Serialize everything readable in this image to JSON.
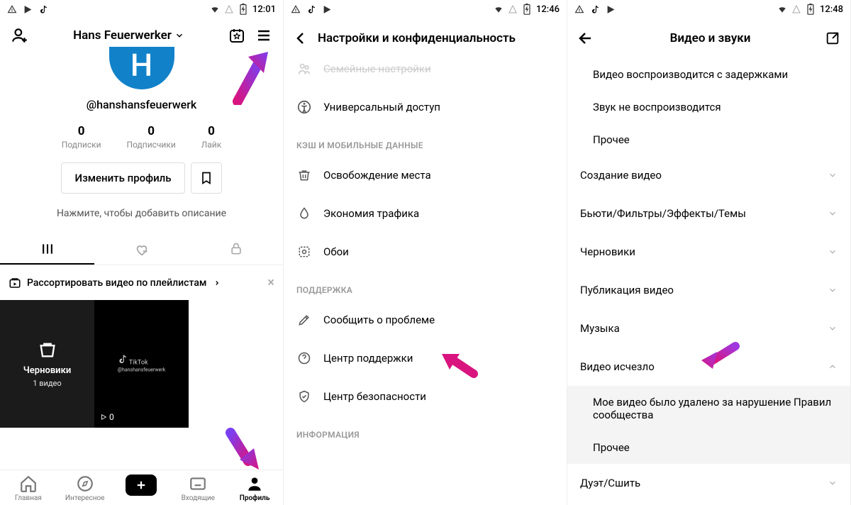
{
  "screen1": {
    "status": {
      "time": "12:01"
    },
    "header": {
      "name": "Hans Feuerwerker"
    },
    "avatar_letter": "H",
    "username": "@hanshansfeuerwerk",
    "stats": [
      {
        "num": "0",
        "label": "Подписки"
      },
      {
        "num": "0",
        "label": "Подписчики"
      },
      {
        "num": "0",
        "label": "Лайк"
      }
    ],
    "edit_button": "Изменить профиль",
    "bio_hint": "Нажмите, чтобы добавить описание",
    "playlist_hint": "Рассортировать видео по плейлистам",
    "drafts": {
      "title": "Черновики",
      "subtitle": "1 видео"
    },
    "video_play": "0",
    "nav": {
      "home": "Главная",
      "discover": "Интересное",
      "inbox": "Входящие",
      "profile": "Профиль"
    }
  },
  "screen2": {
    "status": {
      "time": "12:46"
    },
    "title": "Настройки и конфиденциальность",
    "item_family": "Семейные настройки",
    "item_accessibility": "Универсальный доступ",
    "section_cache": "КЭШ И МОБИЛЬНЫЕ ДАННЫЕ",
    "item_freeup": "Освобождение места",
    "item_datasaver": "Экономия трафика",
    "item_wallpaper": "Обои",
    "section_support": "ПОДДЕРЖКА",
    "item_report": "Сообщить о проблеме",
    "item_helpcenter": "Центр поддержки",
    "item_safety": "Центр безопасности",
    "section_info": "ИНФОРМАЦИЯ"
  },
  "screen3": {
    "status": {
      "time": "12:48"
    },
    "title": "Видео и звуки",
    "item_lag": "Видео воспроизводится с задержками",
    "item_nosound": "Звук не воспроизводится",
    "item_other1": "Прочее",
    "item_create": "Создание видео",
    "item_beauty": "Бьюти/Фильтры/Эффекты/Темы",
    "item_drafts": "Черновики",
    "item_publish": "Публикация видео",
    "item_music": "Музыка",
    "item_disappeared": "Видео исчезло",
    "item_removed": "Мое видео было удалено за нарушение Правил сообщества",
    "item_other2": "Прочее",
    "item_duet": "Дуэт/Сшить"
  }
}
